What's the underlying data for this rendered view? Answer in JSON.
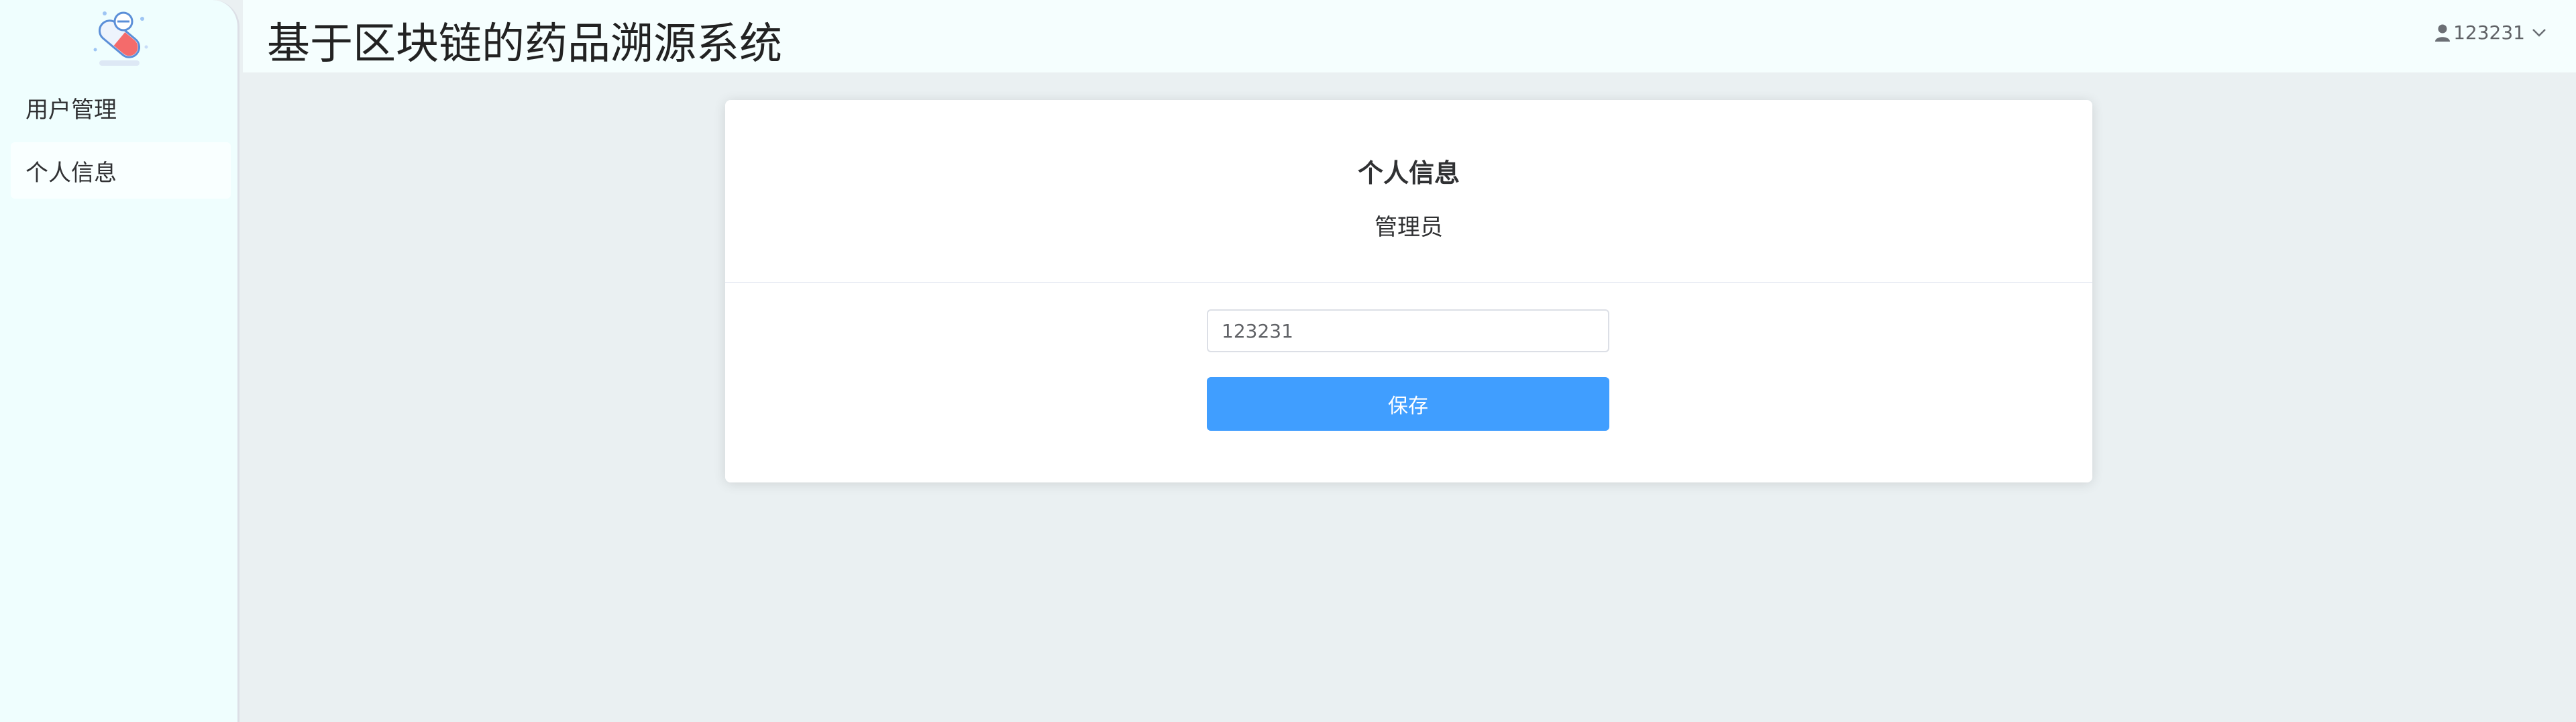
{
  "app": {
    "title": "基于区块链的药品溯源系统"
  },
  "sidebar": {
    "items": [
      {
        "label": "用户管理"
      },
      {
        "label": "个人信息"
      }
    ]
  },
  "header": {
    "user_name": "123231"
  },
  "profile": {
    "title": "个人信息",
    "role": "管理员",
    "name_value": "123231",
    "save_label": "保存"
  },
  "colors": {
    "primary": "#409eff",
    "sidebar_bg": "#effefe",
    "content_bg": "#eaf0f2"
  },
  "icons": {
    "logo": "pill-logo-icon",
    "user": "user-icon",
    "dropdown": "chevron-down-icon"
  }
}
